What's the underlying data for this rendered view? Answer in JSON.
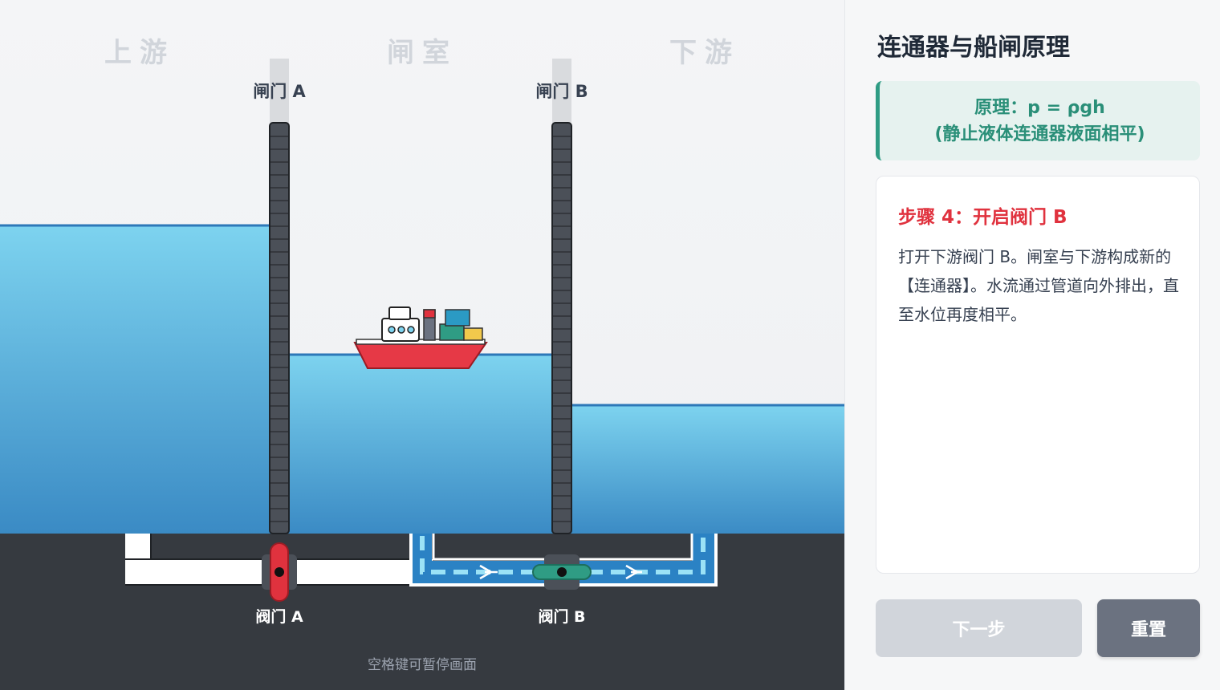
{
  "scene": {
    "zones": {
      "upstream": "上游",
      "chamber": "闸室",
      "downstream": "下游"
    },
    "gates": {
      "a": "闸门 A",
      "b": "闸门 B"
    },
    "valves": {
      "a": "阀门 A",
      "b": "阀门 B"
    },
    "valve_state": {
      "a": "closed",
      "b": "open"
    },
    "hint": "空格键可暂停画面",
    "colors": {
      "water_light": "#7dd3ef",
      "water_deep": "#3a8ac4",
      "ground": "#363a40",
      "gate": "#4b5058",
      "valve_closed": "#e0323e",
      "valve_open": "#2f9c84",
      "ship_hull": "#e63946"
    }
  },
  "panel": {
    "title": "连通器与船闸原理",
    "principle_line1": "原理：p = ρgh",
    "principle_line2": "(静止液体连通器液面相平)",
    "step_title": "步骤 4：开启阀门 B",
    "step_desc": "打开下游阀门 B。闸室与下游构成新的【连通器】。水流通过管道向外排出，直至水位再度相平。",
    "next_button": "下一步",
    "reset_button": "重置"
  }
}
